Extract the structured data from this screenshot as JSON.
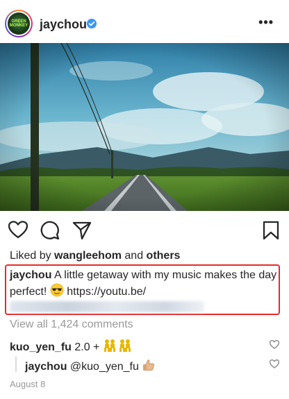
{
  "post": {
    "username": "jaychou",
    "more_label": "•••",
    "avatar_text": "GREEN MONKEY"
  },
  "actions": {
    "like": "heart-icon",
    "comment": "comment-icon",
    "share": "share-icon",
    "save": "bookmark-icon"
  },
  "likes": {
    "prefix": "Liked by ",
    "user": "wangleehom",
    "mid": " and ",
    "others": "others"
  },
  "caption": {
    "username": "jaychou",
    "text": " A little getaway with my music makes the day perfect! ",
    "emoji": "sunglasses-emoji",
    "link": " https://youtu.be/"
  },
  "view_all_comments": "View all 1,424 comments",
  "comments": [
    {
      "username": "kuo_yen_fu",
      "text": " 2.0 + ",
      "emoji": "dancers-emoji"
    },
    {
      "username": "jaychou",
      "text": " @kuo_yen_fu ",
      "emoji": "thumbs-up-emoji"
    }
  ],
  "date": "August 8",
  "colors": {
    "highlight_border": "#e82a2a",
    "verified": "#3897f0",
    "muted_text": "#999999"
  }
}
